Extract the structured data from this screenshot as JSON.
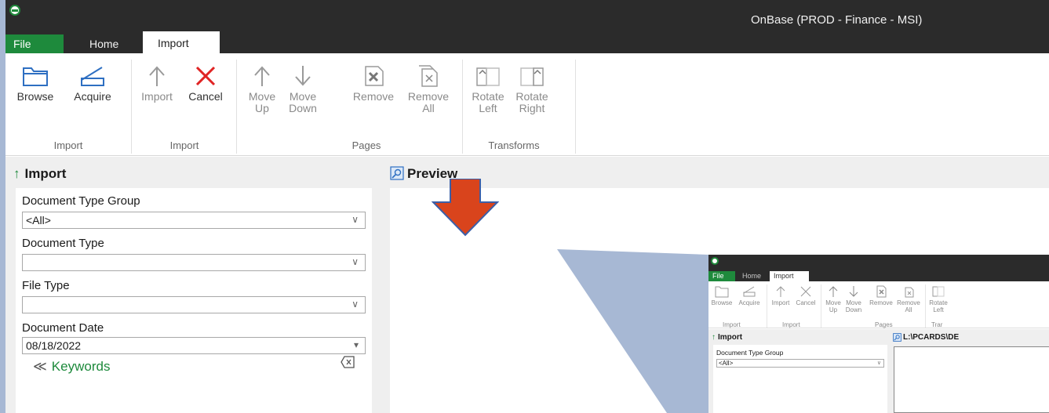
{
  "window": {
    "title": "OnBase (PROD - Finance - MSI)"
  },
  "tabs": [
    {
      "label": "File"
    },
    {
      "label": "Home"
    },
    {
      "label": "Import"
    }
  ],
  "ribbon": {
    "browse": "Browse",
    "acquire": "Acquire",
    "import": "Import",
    "cancel": "Cancel",
    "move_up": [
      "Move",
      "Up"
    ],
    "move_down": [
      "Move",
      "Down"
    ],
    "remove": "Remove",
    "remove_all": [
      "Remove",
      "All"
    ],
    "rotate_left": [
      "Rotate",
      "Left"
    ],
    "rotate_right": [
      "Rotate",
      "Right"
    ],
    "groups": [
      "Import",
      "Import",
      "Pages",
      "Transforms"
    ]
  },
  "import_pane": {
    "title": "Import",
    "fields": [
      {
        "label": "Document Type Group",
        "value": "<All>"
      },
      {
        "label": "Document Type",
        "value": ""
      },
      {
        "label": "File Type",
        "value": ""
      },
      {
        "label": "Document Date",
        "value": "08/18/2022"
      }
    ],
    "keywords_label": "Keywords"
  },
  "preview_pane": {
    "title": "Preview"
  },
  "inset": {
    "tabs": [
      "File",
      "Home",
      "Import"
    ],
    "ribbon": {
      "browse": "Browse",
      "acquire": "Acquire",
      "import": "Import",
      "cancel": "Cancel",
      "move_up": [
        "Move",
        "Up"
      ],
      "move_down": [
        "Move",
        "Down"
      ],
      "remove": "Remove",
      "remove_all": [
        "Remove",
        "All"
      ],
      "rotate_left": [
        "Rotate",
        "Left"
      ],
      "groups": [
        "Import",
        "Import",
        "Pages",
        "Trar"
      ]
    },
    "pane_title": "Import",
    "fields": [
      {
        "label": "Document Type Group",
        "value": "<All>"
      }
    ],
    "preview_path": "L:\\PCARDS\\DE"
  },
  "colors": {
    "brand_green": "#1e8a3c",
    "titlebar": "#2b2b2b",
    "cancel_red": "#e02424",
    "arrow_red": "#d9441c",
    "wedge_blue": "#a7b8d4"
  }
}
